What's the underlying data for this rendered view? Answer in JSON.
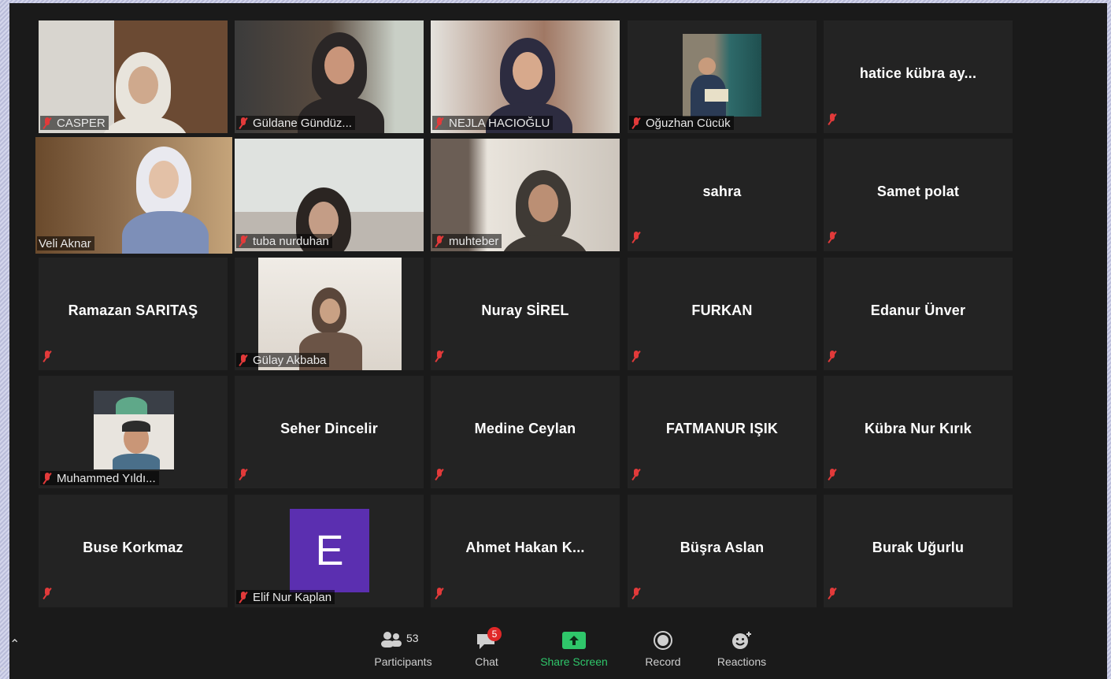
{
  "participants": [
    {
      "name": "CASPER",
      "type": "video"
    },
    {
      "name": "Güldane Gündüz...",
      "type": "video"
    },
    {
      "name": "NEJLA HACIOĞLU",
      "type": "video"
    },
    {
      "name": "Oğuzhan Cücük",
      "type": "video"
    },
    {
      "name": "hatice kübra ay...",
      "type": "name"
    },
    {
      "name": "Veli Aknar",
      "type": "video",
      "active_speaker": true
    },
    {
      "name": "tuba nurduhan",
      "type": "video"
    },
    {
      "name": "muhteber",
      "type": "video"
    },
    {
      "name": "sahra",
      "type": "name"
    },
    {
      "name": "Samet polat",
      "type": "name"
    },
    {
      "name": "Ramazan SARITAŞ",
      "type": "name"
    },
    {
      "name": "Gülay Akbaba",
      "type": "video"
    },
    {
      "name": "Nuray SİREL",
      "type": "name"
    },
    {
      "name": "FURKAN",
      "type": "name"
    },
    {
      "name": "Edanur Ünver",
      "type": "name"
    },
    {
      "name": "Muhammed Yıldı...",
      "type": "video"
    },
    {
      "name": "Seher Dincelir",
      "type": "name"
    },
    {
      "name": "Medine Ceylan",
      "type": "name"
    },
    {
      "name": "FATMANUR IŞIK",
      "type": "name"
    },
    {
      "name": "Kübra Nur Kırık",
      "type": "name"
    },
    {
      "name": "Buse Korkmaz",
      "type": "name"
    },
    {
      "name": "Elif Nur Kaplan",
      "type": "avatar",
      "avatar_letter": "E",
      "avatar_color": "#5b2fb0"
    },
    {
      "name": "Ahmet Hakan K...",
      "type": "name"
    },
    {
      "name": "Büşra Aslan",
      "type": "name"
    },
    {
      "name": "Burak Uğurlu",
      "type": "name"
    }
  ],
  "toolbar": {
    "participants_label": "Participants",
    "participants_count": "53",
    "chat_label": "Chat",
    "chat_badge": "5",
    "share_label": "Share Screen",
    "record_label": "Record",
    "reactions_label": "Reactions"
  },
  "colors": {
    "share_accent": "#2fc66a",
    "active_border": "#c9d94a",
    "muted_mic": "#e23a3a"
  }
}
